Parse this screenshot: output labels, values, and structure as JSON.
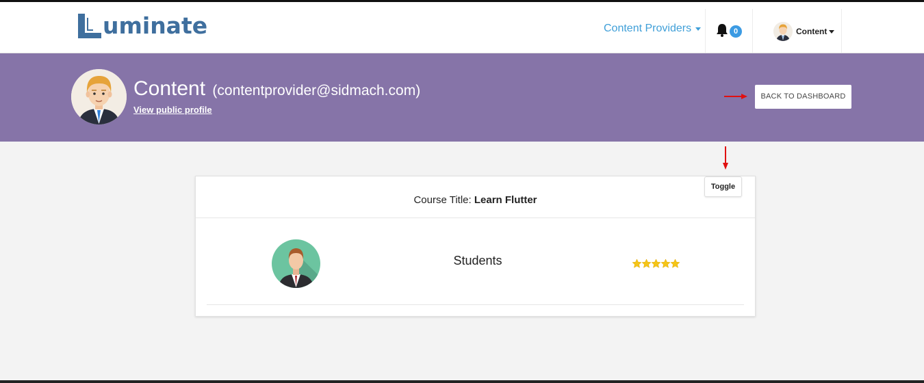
{
  "app": {
    "logo_text": "uminate",
    "logo_alt": "Luminate"
  },
  "nav": {
    "providers_label": "Content Providers",
    "notification_count": "0",
    "user_label": "Content"
  },
  "banner": {
    "name": "Content",
    "email": "(contentprovider@sidmach.com)",
    "public_profile_link": "View public profile",
    "back_button": "BACK TO DASHBOARD"
  },
  "course": {
    "title_prefix": "Course Title:",
    "title": "Learn Flutter",
    "toggle_label": "Toggle",
    "rows": [
      {
        "label": "Students",
        "rating": 5
      }
    ]
  },
  "colors": {
    "banner": "#8674a8",
    "link_blue": "#3f9fd8",
    "logo_blue": "#3f6f9e",
    "badge": "#3c9be3",
    "star": "#f5c518",
    "annotation_arrow": "#e01010"
  },
  "icons": {
    "notification": "bell-icon",
    "rating": "star-icon",
    "annotation": "red-arrow-icon"
  }
}
